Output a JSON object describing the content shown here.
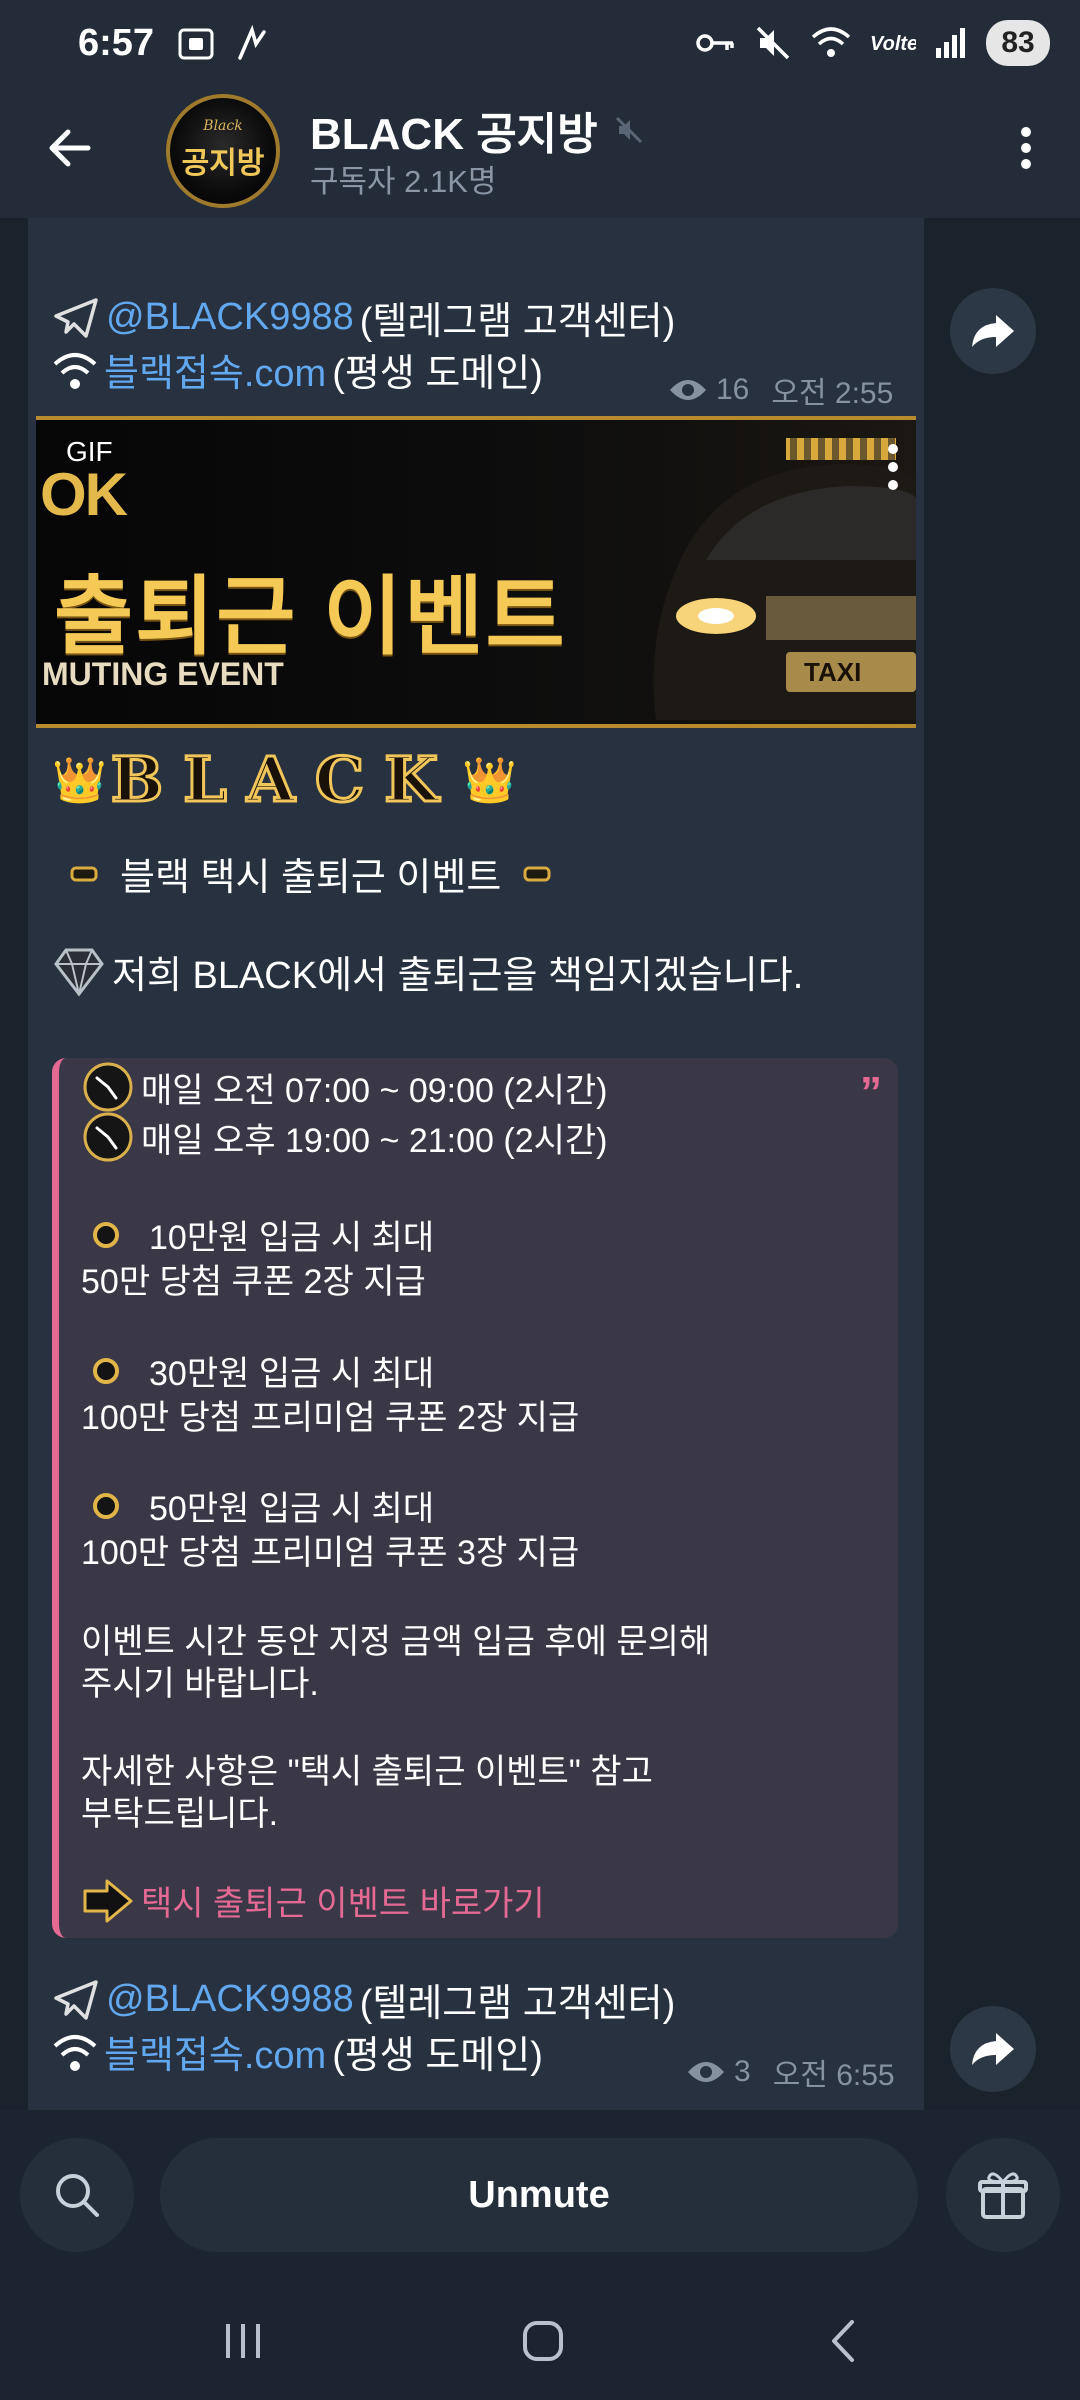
{
  "status_bar": {
    "time": "6:57",
    "battery": "83",
    "icons": [
      "screenshot-icon",
      "nfc-icon",
      "key-icon",
      "mute-icon",
      "wifi-icon",
      "volte-icon",
      "signal-icon"
    ]
  },
  "header": {
    "title": "BLACK 공지방",
    "subtitle": "구독자 2.1K명",
    "avatar_small": "Black",
    "avatar_text": "공지방"
  },
  "messages": {
    "first": {
      "tg_handle": "@BLACK9988",
      "tg_suffix": "(텔레그램 고객센터)",
      "domain_link": "블랙접속.com",
      "domain_suffix": "(평생 도메인)",
      "views": "16",
      "time": "오전 2:55"
    },
    "second": {
      "gif_tag": "GIF",
      "gif_text_top": "OK",
      "gif_title": "출퇴근 이벤트",
      "gif_subtitle": "MUTING EVENT",
      "gif_badge": "TAXI",
      "brand": "BLACK",
      "headline": "블랙 택시 출퇴근 이벤트",
      "intro": "저희 BLACK에서 출퇴근을 책임지겠습니다.",
      "quote": {
        "schedule_1": "매일 오전 07:00 ~ 09:00 (2시간)",
        "schedule_2": "매일 오후 19:00 ~ 21:00 (2시간)",
        "tier_1_title": "10만원 입금 시 최대",
        "tier_1_desc": "50만 당첨 쿠폰 2장 지급",
        "tier_2_title": "30만원 입금 시 최대",
        "tier_2_desc": "100만 당첨 프리미엄 쿠폰 2장 지급",
        "tier_3_title": "50만원 입금 시 최대",
        "tier_3_desc": "100만 당첨 프리미엄 쿠폰 3장 지급",
        "note_1a": "이벤트 시간 동안 지정 금액 입금 후에 문의해",
        "note_1b": "주시기 바랍니다.",
        "note_2a": "자세한 사항은 \"택시 출퇴근 이벤트\" 참고",
        "note_2b": "부탁드립니다.",
        "link_text": "택시 출퇴근 이벤트 바로가기"
      },
      "tg_handle": "@BLACK9988",
      "tg_suffix": "(텔레그램 고객센터)",
      "domain_link": "블랙접속.com",
      "domain_suffix": "(평생 도메인)",
      "views": "3",
      "time": "오전 6:55"
    }
  },
  "bottom": {
    "unmute_label": "Unmute"
  },
  "colors": {
    "link": "#62a8ee",
    "accent_pink": "#e46a93",
    "gold": "#f0c55a",
    "bubble": "#27313f"
  }
}
